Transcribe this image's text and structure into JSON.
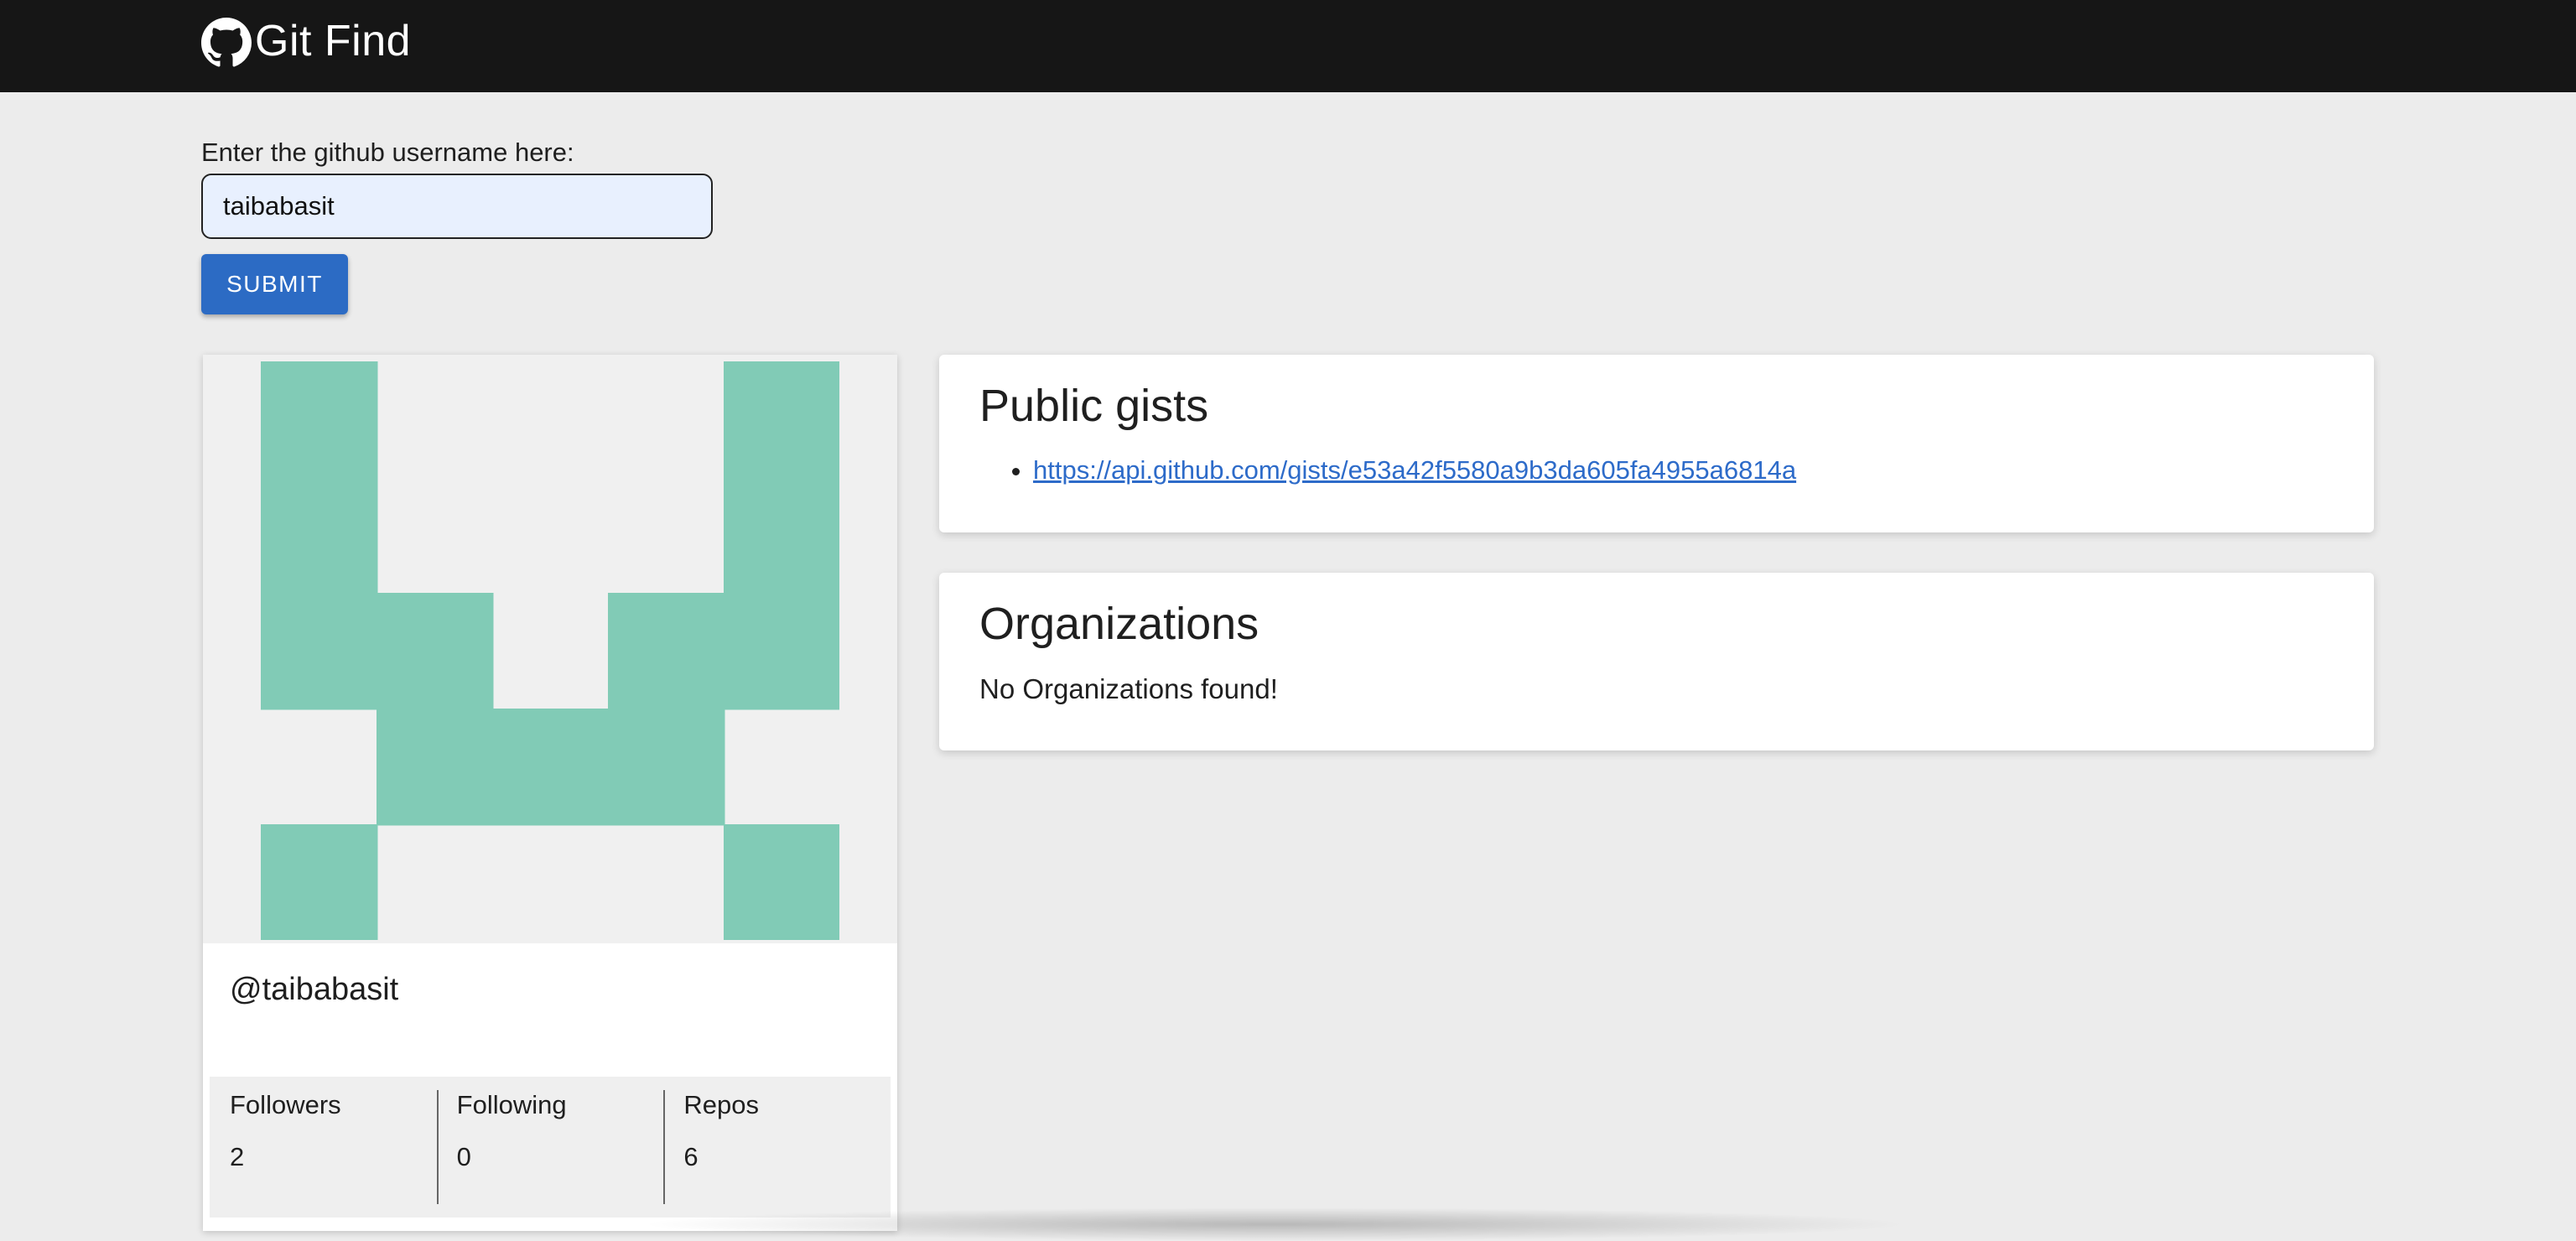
{
  "header": {
    "brand_text": "Git Find",
    "logo_icon": "github-icon"
  },
  "search": {
    "label": "Enter the github username here:",
    "value": "taibabasit",
    "submit_label": "SUBMIT"
  },
  "profile": {
    "handle": "@taibabasit",
    "avatar_color": "#81cbb6",
    "stats": [
      {
        "label": "Followers",
        "value": "2"
      },
      {
        "label": "Following",
        "value": "0"
      },
      {
        "label": "Repos",
        "value": "6"
      }
    ]
  },
  "gists": {
    "title": "Public gists",
    "items": [
      {
        "url": "https://api.github.com/gists/e53a42f5580a9b3da605fa4955a6814a"
      }
    ]
  },
  "organizations": {
    "title": "Organizations",
    "empty_text": "No Organizations found!"
  },
  "colors": {
    "topbar": "#161616",
    "accent": "#2c6bc4",
    "link": "#2d6bc9",
    "background": "#ececec"
  }
}
